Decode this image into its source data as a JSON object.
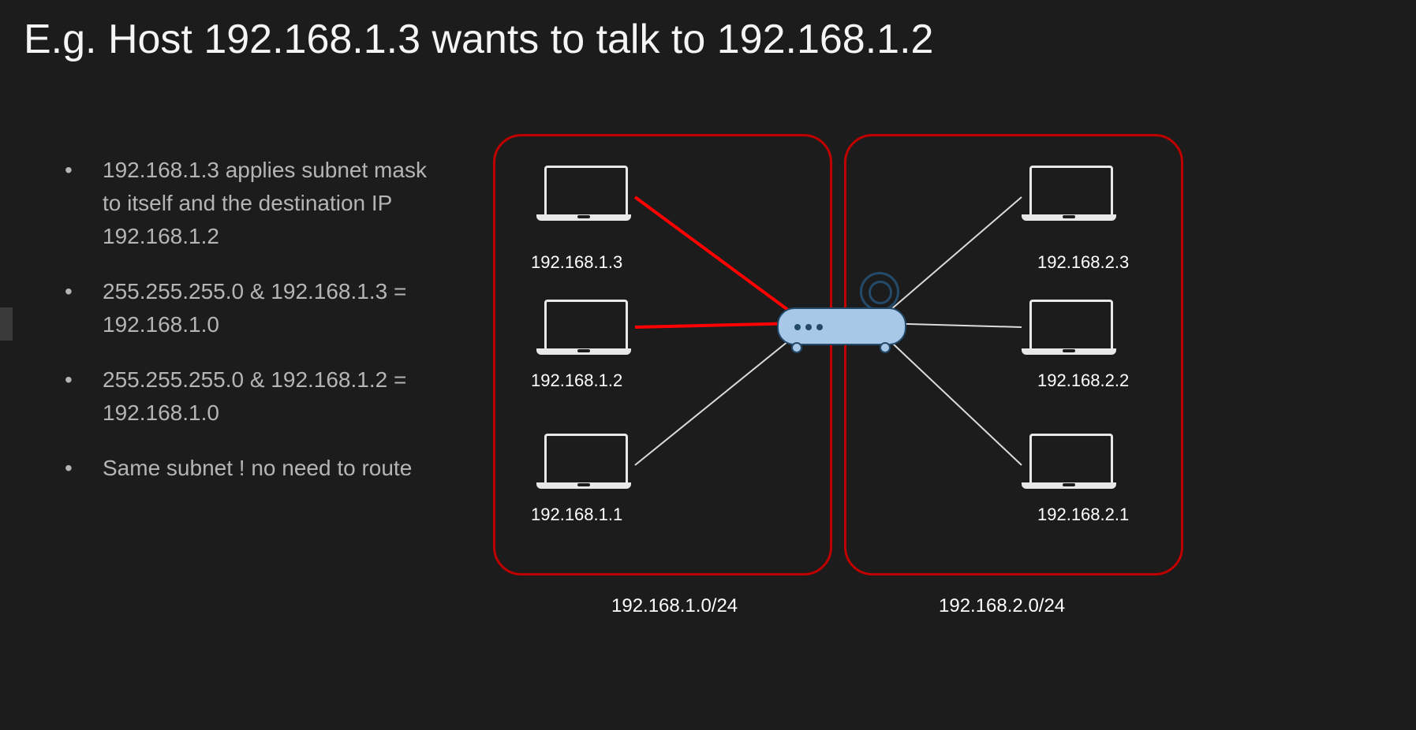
{
  "title": "E.g. Host 192.168.1.3 wants to talk to 192.168.1.2",
  "bullets": [
    "192.168.1.3 applies subnet mask to itself and the destination IP 192.168.1.2",
    "255.255.255.0 & 192.168.1.3 = 192.168.1.0",
    "255.255.255.0 & 192.168.1.2 = 192.168.1.0",
    "Same subnet ! no need to route"
  ],
  "diagram": {
    "subnet_a": {
      "cidr": "192.168.1.0/24",
      "hosts": [
        "192.168.1.3",
        "192.168.1.2",
        "192.168.1.1"
      ]
    },
    "subnet_b": {
      "cidr": "192.168.2.0/24",
      "hosts": [
        "192.168.2.3",
        "192.168.2.2",
        "192.168.2.1"
      ]
    },
    "router": "router",
    "highlighted_links": [
      "192.168.1.3",
      "192.168.1.2"
    ],
    "colors": {
      "highlight": "#ff0000",
      "wire": "#dcdcdc",
      "subnet_border": "#c00000",
      "router_body": "#a8c8e8"
    }
  }
}
